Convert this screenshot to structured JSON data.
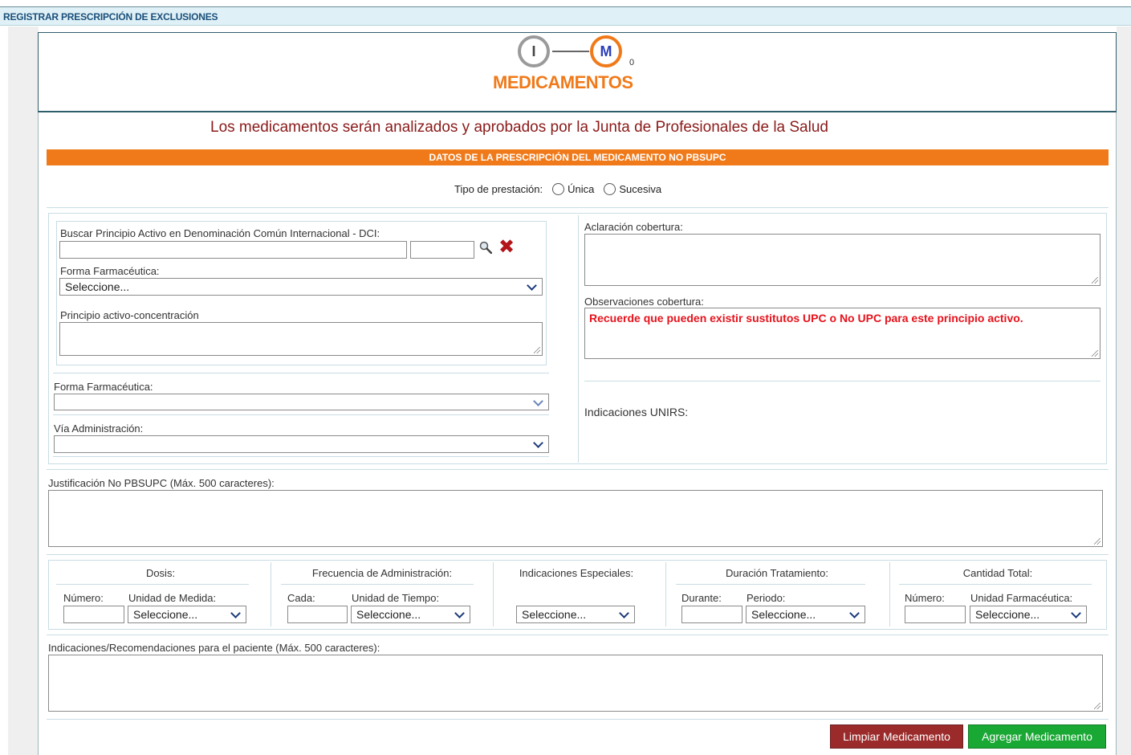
{
  "header": {
    "title": "REGISTRAR PRESCRIPCIÓN DE EXCLUSIONES"
  },
  "steps": {
    "step1_letter": "I",
    "step2_letter": "M",
    "step2_sub": "0",
    "title": "MEDICAMENTOS"
  },
  "notice": "Los medicamentos serán analizados y aprobados por la Junta de Profesionales de la Salud",
  "section_title": "DATOS DE LA PRESCRIPCIÓN DEL MEDICAMENTO NO PBSUPC",
  "tipo": {
    "label": "Tipo de prestación:",
    "options": [
      "Única",
      "Sucesiva"
    ]
  },
  "search": {
    "label": "Buscar Principio Activo en Denominación Común Internacional - DCI:",
    "forma_label": "Forma Farmacéutica:",
    "forma_value": "Seleccione...",
    "principio_label": "Principio activo-concentración"
  },
  "forma2_label": "Forma Farmacéutica:",
  "via_label": "Vía Administración:",
  "right": {
    "aclaracion_label": "Aclaración cobertura:",
    "observaciones_label": "Observaciones cobertura:",
    "observaciones_text": "Recuerde que pueden existir sustitutos UPC o No UPC para este principio activo.",
    "indicaciones_label": "Indicaciones UNIRS:"
  },
  "justificacion_label": "Justificación No PBSUPC (Máx. 500 caracteres):",
  "grid": {
    "dosis": {
      "title": "Dosis:",
      "num_label": "Número:",
      "unit_label": "Unidad de Medida:",
      "unit_value": "Seleccione..."
    },
    "frecuencia": {
      "title": "Frecuencia de Administración:",
      "cada_label": "Cada:",
      "unit_label": "Unidad de Tiempo:",
      "unit_value": "Seleccione..."
    },
    "especiales": {
      "title": "Indicaciones Especiales:",
      "value": "Seleccione..."
    },
    "duracion": {
      "title": "Duración Tratamiento:",
      "durante_label": "Durante:",
      "periodo_label": "Periodo:",
      "periodo_value": "Seleccione..."
    },
    "cantidad": {
      "title": "Cantidad Total:",
      "num_label": "Número:",
      "unit_label": "Unidad Farmacéutica:",
      "unit_value": "Seleccione..."
    }
  },
  "recomendaciones_label": "Indicaciones/Recomendaciones para el paciente (Máx. 500 caracteres):",
  "buttons": {
    "clear": "Limpiar Medicamento",
    "add": "Agregar Medicamento"
  },
  "colors": {
    "accent": "#f07a1a",
    "notice": "#8b1a1a",
    "clear_btn": "#9b2a2a",
    "add_btn": "#1aa834"
  },
  "icons": [
    "search-icon",
    "clear-x-icon",
    "chevron-down-icon"
  ]
}
